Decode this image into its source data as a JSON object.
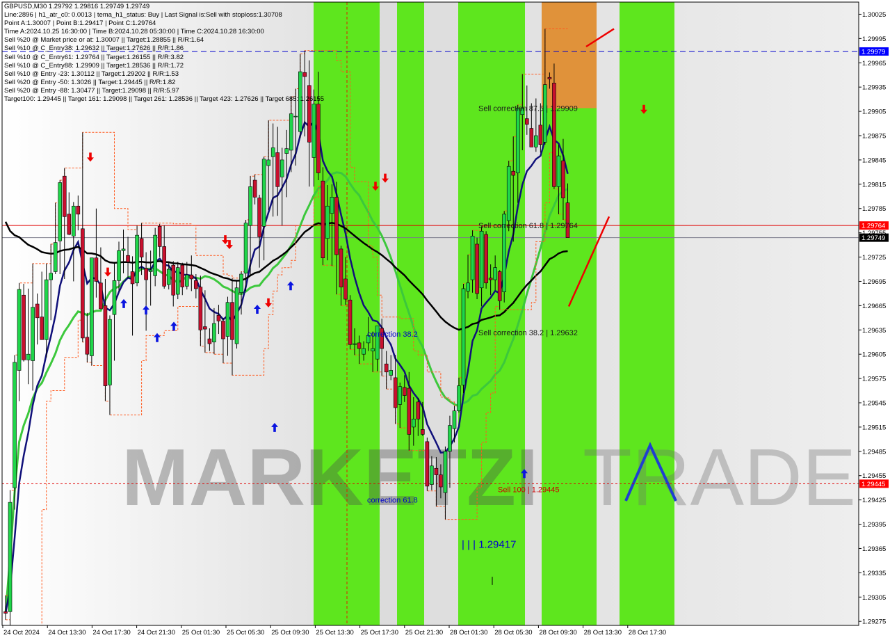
{
  "header": {
    "lines": [
      "GBPUSD,M30  1.29792 1.29816 1.29749 1.29749",
      "Line:2896 | h1_atr_c0: 0.0013 | tema_h1_status: Buy | Last Signal is:Sell with stoploss:1.30708",
      "Point A:1.30007 | Point B:1.29417 | Point C:1.29764",
      "Time A:2024.10.25 16:30:00 | Time B:2024.10.28 05:30:00 | Time C:2024.10.28 16:30:00",
      "Sell %20 @ Market price or at: 1.30007 || Target:1.28855 || R/R:1.64",
      "Sell %10 @ C_Entry38: 1.29632 || Target:1.27626 || R/R:1.86",
      "Sell %10 @ C_Entry61: 1.29764 || Target:1.26155 || R/R:3.82",
      "Sell %10 @ C_Entry88: 1.29909 || Target:1.28536 || R/R:1.72",
      "Sell %10 @ Entry -23: 1.30112 || Target:1.29202 || R/R:1.53",
      "Sell %20 @ Entry -50: 1.3026 || Target:1.29445 || R/R:1.82",
      "Sell %20 @ Entry -88: 1.30477 || Target:1.29098 || R/R:5.97",
      "Target100: 1.29445 || Target 161: 1.29098 || Target 261: 1.28536 || Target 423: 1.27626 || Target 685: 1.26155"
    ]
  },
  "watermark": {
    "left": "MARKETZI",
    "right": "TRADE"
  },
  "price_tags": [
    {
      "label": "1.29979",
      "value": 1.29979,
      "bg": "#0000ff"
    },
    {
      "label": "1.29764",
      "value": 1.29764,
      "bg": "#ff0000"
    },
    {
      "label": "1.29749",
      "value": 1.29749,
      "bg": "#000000"
    },
    {
      "label": "1.29445",
      "value": 1.29445,
      "bg": "#ff0000"
    }
  ],
  "annotations": [
    {
      "text": "Sell correction 87.5 | 1.29909",
      "color": "#1a1a1a"
    },
    {
      "text": "Sell correction 61.8 | 1.29764",
      "color": "#1a1a1a"
    },
    {
      "text": "Sell correction 38.2 | 1.29632",
      "color": "#1a1a1a"
    },
    {
      "text": "correction 38.2",
      "color": "#0000cc"
    },
    {
      "text": "correction 61.8",
      "color": "#0000cc"
    },
    {
      "text": "Sell 100 | 1.29445",
      "color": "#cc0000"
    },
    {
      "text": "| | | 1.29417",
      "color": "#0000cc"
    }
  ],
  "colors": {
    "green_zone": "#5ee61e",
    "orange_zone": "#e0923a",
    "bull": "#1fd64a",
    "bear": "#c8102e",
    "ma_black": "#000000",
    "ma_navy": "#10107a",
    "ma_green": "#3cc83c",
    "fractal": "#ff5a1f"
  },
  "chart_data": {
    "type": "candlestick",
    "title": "GBPUSD,M30",
    "ylim": [
      1.2927,
      1.3004
    ],
    "y_ticks": [
      "1.30025",
      "1.29995",
      "1.29965",
      "1.29935",
      "1.29905",
      "1.29875",
      "1.29845",
      "1.29815",
      "1.29785",
      "1.29755",
      "1.29725",
      "1.29695",
      "1.29665",
      "1.29635",
      "1.29605",
      "1.29575",
      "1.29545",
      "1.29515",
      "1.29485",
      "1.29455",
      "1.29425",
      "1.29395",
      "1.29365",
      "1.29335",
      "1.29305",
      "1.29275"
    ],
    "x_ticks": [
      "24 Oct 2024",
      "24 Oct 13:30",
      "24 Oct 17:30",
      "24 Oct 21:30",
      "25 Oct 01:30",
      "25 Oct 05:30",
      "25 Oct 09:30",
      "25 Oct 13:30",
      "25 Oct 17:30",
      "25 Oct 21:30",
      "28 Oct 01:30",
      "28 Oct 05:30",
      "28 Oct 09:30",
      "28 Oct 13:30",
      "28 Oct 17:30"
    ],
    "ohlc": [
      [
        1.29287,
        1.29307,
        1.29277,
        1.29285
      ],
      [
        1.29287,
        1.29437,
        1.29267,
        1.29422
      ],
      [
        1.2944,
        1.29604,
        1.29413,
        1.29595
      ],
      [
        1.29585,
        1.29693,
        1.29547,
        1.29685
      ],
      [
        1.29678,
        1.29692,
        1.29596,
        1.29598
      ],
      [
        1.29598,
        1.29686,
        1.29568,
        1.29605
      ],
      [
        1.29597,
        1.29717,
        1.2956,
        1.29663
      ],
      [
        1.29667,
        1.2968,
        1.29617,
        1.2965
      ],
      [
        1.29651,
        1.29707,
        1.29624,
        1.29623
      ],
      [
        1.29623,
        1.29717,
        1.29601,
        1.29697
      ],
      [
        1.29697,
        1.29741,
        1.29647,
        1.29705
      ],
      [
        1.29707,
        1.29792,
        1.29704,
        1.29743
      ],
      [
        1.29745,
        1.2982,
        1.29704,
        1.29817
      ],
      [
        1.29825,
        1.29835,
        1.29698,
        1.29775
      ],
      [
        1.29778,
        1.29805,
        1.29752,
        1.29753
      ],
      [
        1.29751,
        1.29793,
        1.29695,
        1.29788
      ],
      [
        1.29788,
        1.29801,
        1.29758,
        1.29778
      ],
      [
        1.2976,
        1.29879,
        1.2962,
        1.29625
      ],
      [
        1.29626,
        1.29656,
        1.29595,
        1.29605
      ],
      [
        1.29603,
        1.29724,
        1.29591,
        1.29724
      ],
      [
        1.29724,
        1.29785,
        1.29675,
        1.29695
      ],
      [
        1.29693,
        1.29737,
        1.29662,
        1.29661
      ],
      [
        1.29665,
        1.29698,
        1.29547,
        1.29566
      ],
      [
        1.29567,
        1.29653,
        1.2953,
        1.29648
      ],
      [
        1.29654,
        1.29719,
        1.29597,
        1.29696
      ],
      [
        1.29696,
        1.29744,
        1.29683,
        1.29733
      ],
      [
        1.29733,
        1.29759,
        1.29705,
        1.29735
      ],
      [
        1.29727,
        1.2975,
        1.29699,
        1.29719
      ],
      [
        1.29707,
        1.29726,
        1.29628,
        1.29692
      ],
      [
        1.29693,
        1.29764,
        1.29689,
        1.29752
      ],
      [
        1.29748,
        1.29767,
        1.29703,
        1.29725
      ],
      [
        1.29711,
        1.29731,
        1.29634,
        1.29697
      ],
      [
        1.29707,
        1.29733,
        1.29665,
        1.29709
      ],
      [
        1.29702,
        1.29761,
        1.29689,
        1.29752
      ],
      [
        1.29763,
        1.29766,
        1.29725,
        1.29738
      ],
      [
        1.29738,
        1.29764,
        1.29686,
        1.29689
      ],
      [
        1.29691,
        1.29719,
        1.29685,
        1.2971
      ],
      [
        1.29715,
        1.2972,
        1.29664,
        1.29678
      ],
      [
        1.29679,
        1.29719,
        1.29673,
        1.29712
      ],
      [
        1.29715,
        1.29718,
        1.29678,
        1.29688
      ],
      [
        1.29689,
        1.29719,
        1.29685,
        1.29703
      ],
      [
        1.29703,
        1.29727,
        1.29683,
        1.29698
      ],
      [
        1.29696,
        1.29704,
        1.29674,
        1.29686
      ],
      [
        1.29688,
        1.29702,
        1.29615,
        1.29635
      ],
      [
        1.29639,
        1.29684,
        1.29607,
        1.29636
      ],
      [
        1.29624,
        1.29637,
        1.29609,
        1.29618
      ],
      [
        1.2962,
        1.29662,
        1.29605,
        1.29643
      ],
      [
        1.29653,
        1.29666,
        1.2963,
        1.29646
      ],
      [
        1.29646,
        1.2965,
        1.29594,
        1.29624
      ],
      [
        1.29627,
        1.29676,
        1.29603,
        1.29669
      ],
      [
        1.29669,
        1.29699,
        1.29579,
        1.29623
      ],
      [
        1.29618,
        1.29696,
        1.29612,
        1.29687
      ],
      [
        1.29681,
        1.29707,
        1.29654,
        1.29704
      ],
      [
        1.29705,
        1.29771,
        1.29683,
        1.29767
      ],
      [
        1.29764,
        1.29825,
        1.29703,
        1.29812
      ],
      [
        1.2982,
        1.29827,
        1.2979,
        1.29799
      ],
      [
        1.29798,
        1.29802,
        1.29712,
        1.2975
      ],
      [
        1.29763,
        1.29849,
        1.29721,
        1.29846
      ],
      [
        1.29838,
        1.29894,
        1.29783,
        1.29845
      ],
      [
        1.29849,
        1.2989,
        1.29775,
        1.2986
      ],
      [
        1.29854,
        1.29886,
        1.29776,
        1.29812
      ],
      [
        1.29824,
        1.2986,
        1.29764,
        1.29845
      ],
      [
        1.29853,
        1.29882,
        1.29799,
        1.29859
      ],
      [
        1.29857,
        1.29923,
        1.2983,
        1.29902
      ],
      [
        1.29899,
        1.29933,
        1.29838,
        1.29899
      ],
      [
        1.2988,
        1.29976,
        1.29872,
        1.29954
      ],
      [
        1.29953,
        1.2998,
        1.29874,
        1.29948
      ],
      [
        1.29937,
        1.29968,
        1.29812,
        1.29867
      ],
      [
        1.29848,
        1.29932,
        1.29812,
        1.29914
      ],
      [
        1.29914,
        1.29954,
        1.2982,
        1.29829
      ],
      [
        1.29819,
        1.29836,
        1.29715,
        1.29724
      ],
      [
        1.29748,
        1.29814,
        1.29721,
        1.29788
      ],
      [
        1.29779,
        1.29815,
        1.29714,
        1.29799
      ],
      [
        1.29799,
        1.29818,
        1.29679,
        1.29728
      ],
      [
        1.29735,
        1.29739,
        1.29665,
        1.29688
      ],
      [
        1.29698,
        1.29725,
        1.29666,
        1.29673
      ],
      [
        1.29672,
        1.29678,
        1.29611,
        1.29617
      ],
      [
        1.29617,
        1.29637,
        1.29604,
        1.29618
      ],
      [
        1.29619,
        1.29628,
        1.29593,
        1.29612
      ],
      [
        1.29605,
        1.29621,
        1.29597,
        1.29612
      ],
      [
        1.29619,
        1.29651,
        1.29609,
        1.29628
      ],
      [
        1.29609,
        1.29633,
        1.29583,
        1.29612
      ],
      [
        1.29599,
        1.29637,
        1.29584,
        1.2964
      ],
      [
        1.29637,
        1.29649,
        1.29578,
        1.29612
      ],
      [
        1.29593,
        1.29609,
        1.29562,
        1.29583
      ],
      [
        1.29579,
        1.29604,
        1.29573,
        1.29585
      ],
      [
        1.29576,
        1.29604,
        1.29519,
        1.29539
      ],
      [
        1.29543,
        1.2957,
        1.29514,
        1.29565
      ],
      [
        1.29564,
        1.29579,
        1.29546,
        1.29554
      ],
      [
        1.29563,
        1.29583,
        1.29486,
        1.29506
      ],
      [
        1.29515,
        1.29552,
        1.29492,
        1.29525
      ],
      [
        1.29546,
        1.29551,
        1.29504,
        1.29525
      ],
      [
        1.29512,
        1.29546,
        1.29504,
        1.29506
      ],
      [
        1.29497,
        1.29502,
        1.29436,
        1.29442
      ],
      [
        1.29444,
        1.29479,
        1.29437,
        1.29467
      ],
      [
        1.29464,
        1.29478,
        1.29417,
        1.29456
      ],
      [
        1.29456,
        1.29469,
        1.29427,
        1.29441
      ],
      [
        1.29434,
        1.29491,
        1.29401,
        1.29485
      ],
      [
        1.29485,
        1.29529,
        1.2944,
        1.29517
      ],
      [
        1.29513,
        1.29541,
        1.29496,
        1.29535
      ],
      [
        1.29535,
        1.29576,
        1.29533,
        1.29566
      ],
      [
        1.29567,
        1.29692,
        1.29557,
        1.29686
      ],
      [
        1.29683,
        1.29728,
        1.29674,
        1.29693
      ],
      [
        1.29697,
        1.29758,
        1.29681,
        1.29751
      ],
      [
        1.29741,
        1.29749,
        1.29673,
        1.2968
      ],
      [
        1.29687,
        1.29763,
        1.29664,
        1.29757
      ],
      [
        1.29753,
        1.29757,
        1.29686,
        1.29693
      ],
      [
        1.29699,
        1.29716,
        1.29678,
        1.29697
      ],
      [
        1.29697,
        1.29727,
        1.29684,
        1.29712
      ],
      [
        1.29707,
        1.29709,
        1.2966,
        1.29671
      ],
      [
        1.29682,
        1.29782,
        1.29669,
        1.29778
      ],
      [
        1.2977,
        1.29844,
        1.29757,
        1.29837
      ],
      [
        1.29831,
        1.29874,
        1.29744,
        1.29826
      ],
      [
        1.29829,
        1.29913,
        1.29792,
        1.29909
      ],
      [
        1.29901,
        1.29951,
        1.29857,
        1.29909
      ],
      [
        1.29896,
        1.29937,
        1.29876,
        1.29889
      ],
      [
        1.29884,
        1.29915,
        1.29862,
        1.29861
      ],
      [
        1.29861,
        1.29921,
        1.29855,
        1.29875
      ],
      [
        1.29888,
        1.29915,
        1.29854,
        1.29864
      ],
      [
        1.29867,
        1.30007,
        1.29864,
        1.29938
      ],
      [
        1.29947,
        1.29953,
        1.29933,
        1.29945
      ],
      [
        1.2994,
        1.29964,
        1.29809,
        1.29812
      ],
      [
        1.29812,
        1.29864,
        1.29778,
        1.2985
      ],
      [
        1.29844,
        1.29871,
        1.29771,
        1.29798
      ],
      [
        1.29792,
        1.29816,
        1.29749,
        1.29749
      ]
    ]
  }
}
